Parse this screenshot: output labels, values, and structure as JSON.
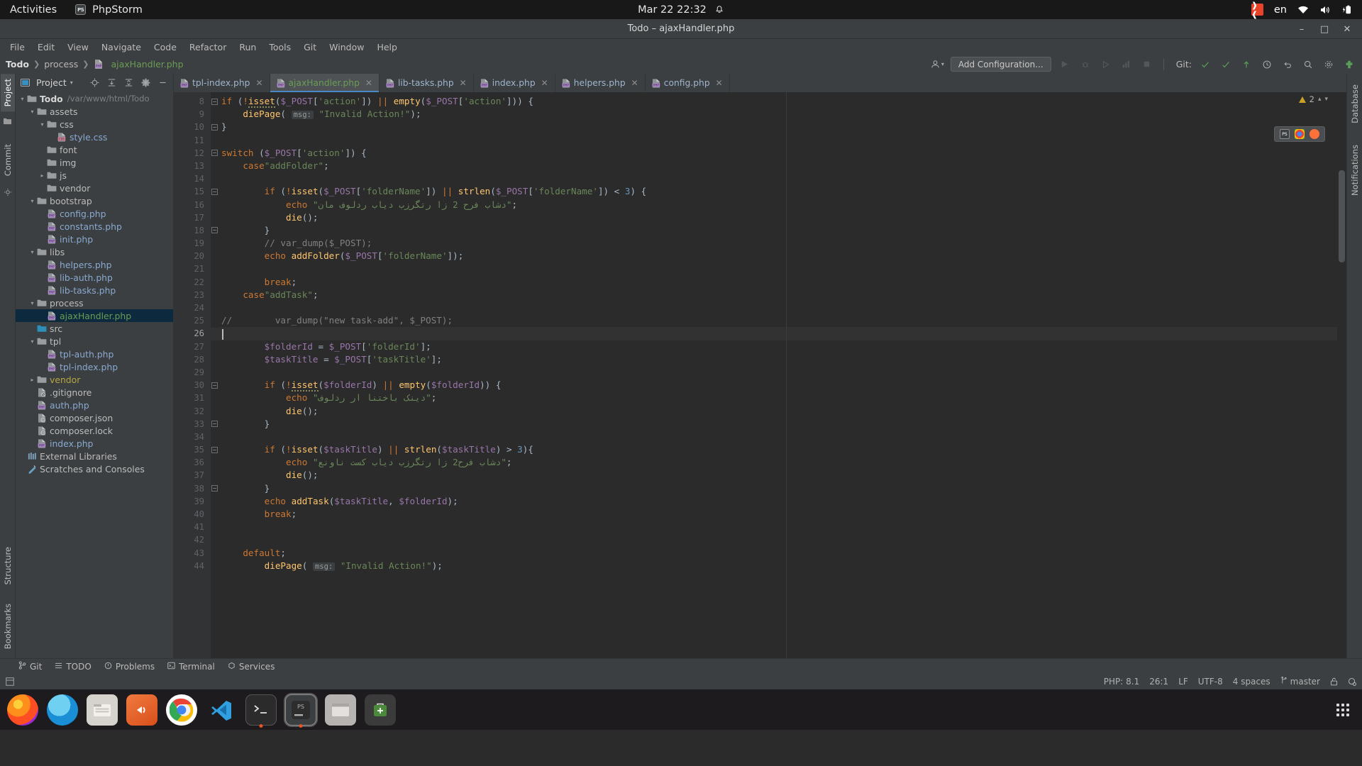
{
  "gnome": {
    "activities": "Activities",
    "app_name": "PhpStorm",
    "app_icon": "phpstorm-icon",
    "clock": "Mar 22  22:32",
    "bell_icon": "notification-bell-icon",
    "tray_icon": "redhat-tray-icon",
    "language": "en",
    "wifi_icon": "wifi-icon",
    "volume_icon": "volume-icon",
    "battery_icon": "battery-charging-icon"
  },
  "window": {
    "title": "Todo – ajaxHandler.php",
    "minimize": "–",
    "maximize": "□",
    "close": "✕"
  },
  "menu": [
    "File",
    "Edit",
    "View",
    "Navigate",
    "Code",
    "Refactor",
    "Run",
    "Tools",
    "Git",
    "Window",
    "Help"
  ],
  "navbar": {
    "breadcrumb": [
      "Todo",
      "process",
      "ajaxHandler.php"
    ],
    "add_configuration": "Add Configuration...",
    "git_label": "Git:",
    "icons": [
      "user-profile-icon",
      "run-icon",
      "debug-icon",
      "run-with-coverage-icon",
      "profile-icon",
      "stop-icon",
      "git-update-icon",
      "git-commit-icon",
      "git-push-icon",
      "git-history-icon",
      "undo-icon",
      "search-icon",
      "settings-icon",
      "plugin-icon"
    ]
  },
  "left_strip": {
    "tabs": [
      "Project",
      "Commit"
    ],
    "bottom_tabs": [
      "Structure",
      "Bookmarks"
    ],
    "active": "Project"
  },
  "right_strip": {
    "tabs": [
      "Database",
      "Notifications"
    ]
  },
  "project_panel": {
    "title": "Project",
    "icons": [
      "locate-icon",
      "expand-all-icon",
      "collapse-all-icon",
      "settings-icon",
      "hide-icon"
    ],
    "tree": [
      {
        "label": "Todo",
        "sub": "/var/www/html/Todo",
        "depth": 0,
        "arrow": "down",
        "icon": "folder-icon",
        "style": "b",
        "sel": false
      },
      {
        "label": "assets",
        "sub": "",
        "depth": 1,
        "arrow": "down",
        "icon": "folder-icon",
        "style": "plain",
        "sel": false
      },
      {
        "label": "css",
        "sub": "",
        "depth": 2,
        "arrow": "down",
        "icon": "folder-icon",
        "style": "plain",
        "sel": false
      },
      {
        "label": "style.css",
        "sub": "",
        "depth": 3,
        "arrow": "",
        "icon": "css-file-icon",
        "style": "css",
        "sel": false
      },
      {
        "label": "font",
        "sub": "",
        "depth": 2,
        "arrow": "",
        "icon": "folder-icon",
        "style": "plain",
        "sel": false
      },
      {
        "label": "img",
        "sub": "",
        "depth": 2,
        "arrow": "",
        "icon": "folder-icon",
        "style": "plain",
        "sel": false
      },
      {
        "label": "js",
        "sub": "",
        "depth": 2,
        "arrow": "right",
        "icon": "folder-icon",
        "style": "plain",
        "sel": false
      },
      {
        "label": "vendor",
        "sub": "",
        "depth": 2,
        "arrow": "",
        "icon": "folder-icon",
        "style": "plain",
        "sel": false
      },
      {
        "label": "bootstrap",
        "sub": "",
        "depth": 1,
        "arrow": "down",
        "icon": "folder-icon",
        "style": "plain",
        "sel": false
      },
      {
        "label": "config.php",
        "sub": "",
        "depth": 2,
        "arrow": "",
        "icon": "php-file-icon",
        "style": "php",
        "sel": false
      },
      {
        "label": "constants.php",
        "sub": "",
        "depth": 2,
        "arrow": "",
        "icon": "php-file-icon",
        "style": "php",
        "sel": false
      },
      {
        "label": "init.php",
        "sub": "",
        "depth": 2,
        "arrow": "",
        "icon": "php-file-icon",
        "style": "php",
        "sel": false
      },
      {
        "label": "libs",
        "sub": "",
        "depth": 1,
        "arrow": "down",
        "icon": "folder-icon",
        "style": "plain",
        "sel": false
      },
      {
        "label": "helpers.php",
        "sub": "",
        "depth": 2,
        "arrow": "",
        "icon": "php-file-icon",
        "style": "php",
        "sel": false
      },
      {
        "label": "lib-auth.php",
        "sub": "",
        "depth": 2,
        "arrow": "",
        "icon": "php-file-icon",
        "style": "php",
        "sel": false
      },
      {
        "label": "lib-tasks.php",
        "sub": "",
        "depth": 2,
        "arrow": "",
        "icon": "php-file-icon",
        "style": "php",
        "sel": false
      },
      {
        "label": "process",
        "sub": "",
        "depth": 1,
        "arrow": "down",
        "icon": "folder-icon",
        "style": "plain",
        "sel": false
      },
      {
        "label": "ajaxHandler.php",
        "sub": "",
        "depth": 2,
        "arrow": "",
        "icon": "php-file-icon",
        "style": "green",
        "sel": true
      },
      {
        "label": "src",
        "sub": "",
        "depth": 1,
        "arrow": "",
        "icon": "folder-blue-icon",
        "style": "plain",
        "sel": false
      },
      {
        "label": "tpl",
        "sub": "",
        "depth": 1,
        "arrow": "down",
        "icon": "folder-icon",
        "style": "plain",
        "sel": false
      },
      {
        "label": "tpl-auth.php",
        "sub": "",
        "depth": 2,
        "arrow": "",
        "icon": "php-file-icon",
        "style": "php",
        "sel": false
      },
      {
        "label": "tpl-index.php",
        "sub": "",
        "depth": 2,
        "arrow": "",
        "icon": "php-file-icon",
        "style": "php",
        "sel": false
      },
      {
        "label": "vendor",
        "sub": "",
        "depth": 1,
        "arrow": "right",
        "icon": "folder-icon",
        "style": "yellow",
        "sel": false
      },
      {
        "label": ".gitignore",
        "sub": "",
        "depth": 1,
        "arrow": "",
        "icon": "gitignore-file-icon",
        "style": "plain",
        "sel": false
      },
      {
        "label": "auth.php",
        "sub": "",
        "depth": 1,
        "arrow": "",
        "icon": "php-file-icon",
        "style": "php",
        "sel": false
      },
      {
        "label": "composer.json",
        "sub": "",
        "depth": 1,
        "arrow": "",
        "icon": "composer-file-icon",
        "style": "plain",
        "sel": false
      },
      {
        "label": "composer.lock",
        "sub": "",
        "depth": 1,
        "arrow": "",
        "icon": "composer-file-icon",
        "style": "plain",
        "sel": false
      },
      {
        "label": "index.php",
        "sub": "",
        "depth": 1,
        "arrow": "",
        "icon": "php-file-icon",
        "style": "php",
        "sel": false
      },
      {
        "label": "External Libraries",
        "sub": "",
        "depth": 0,
        "arrow": "",
        "icon": "external-libraries-icon",
        "style": "plain",
        "sel": false
      },
      {
        "label": "Scratches and Consoles",
        "sub": "",
        "depth": 0,
        "arrow": "",
        "icon": "scratches-icon",
        "style": "plain",
        "sel": false
      }
    ]
  },
  "tabs": [
    {
      "label": "tpl-index.php",
      "active": false
    },
    {
      "label": "ajaxHandler.php",
      "active": true
    },
    {
      "label": "lib-tasks.php",
      "active": false
    },
    {
      "label": "index.php",
      "active": false
    },
    {
      "label": "helpers.php",
      "active": false
    },
    {
      "label": "config.php",
      "active": false
    }
  ],
  "editor": {
    "first_line": 8,
    "current_line": 26,
    "inspections": "2",
    "browser_popup_icons": [
      "phpstorm-run-icon",
      "chrome-icon",
      "firefox-icon"
    ],
    "lines": [
      {
        "n": 8,
        "html": "<span class=\"k\">if</span> (<span class=\"k\">!</span><span class=\"f squig\">isset</span>(<span class=\"v\">$_POST</span>[<span class=\"s\">'action'</span>])<span class=\"p\"> </span><span class=\"pipe\">||</span> <span class=\"f\">empty</span>(<span class=\"v\">$_POST</span>[<span class=\"s\">'action'</span>])) {"
      },
      {
        "n": 9,
        "html": "    <span class=\"f\">diePage</span>( <span class=\"hint\">msg:</span> <span class=\"s\">\"Invalid Action!\"</span>);"
      },
      {
        "n": 10,
        "html": "}"
      },
      {
        "n": 11,
        "html": ""
      },
      {
        "n": 12,
        "html": "<span class=\"k\">switch</span> (<span class=\"v\">$_POST</span>[<span class=\"s\">'action'</span>]) {"
      },
      {
        "n": 13,
        "html": "    <span class=\"k\">case</span><span class=\"s\">\"addFolder\"</span>;"
      },
      {
        "n": 14,
        "html": ""
      },
      {
        "n": 15,
        "html": "        <span class=\"k\">if</span> (<span class=\"k\">!</span><span class=\"f\">isset</span>(<span class=\"v\">$_POST</span>[<span class=\"s\">'folderName'</span>])<span class=\"p\"> </span><span class=\"pipe\">||</span> <span class=\"f\">strlen</span>(<span class=\"v\">$_POST</span>[<span class=\"s\">'folderName'</span>]) &lt; <span class=\"n\">3</span>) {"
      },
      {
        "n": 16,
        "html": "            <span class=\"k\">echo</span> <span class=\"s\">\"<span class=\"rtl\">دشاب فرح 2 زا رتگرزب دیاب ردلوف مان</span>\"</span>;"
      },
      {
        "n": 17,
        "html": "            <span class=\"f\">die</span>();"
      },
      {
        "n": 18,
        "html": "        }"
      },
      {
        "n": 19,
        "html": "        <span class=\"c\">// var_dump($_POST);</span>"
      },
      {
        "n": 20,
        "html": "        <span class=\"k\">echo</span> <span class=\"f\">addFolder</span>(<span class=\"v\">$_POST</span>[<span class=\"s\">'folderName'</span>]);"
      },
      {
        "n": 21,
        "html": ""
      },
      {
        "n": 22,
        "html": "        <span class=\"k\">break</span>;"
      },
      {
        "n": 23,
        "html": "    <span class=\"k\">case</span><span class=\"s\">\"addTask\"</span>;"
      },
      {
        "n": 24,
        "html": ""
      },
      {
        "n": 25,
        "html": "<span class=\"c\">//        var_dump(\"new task-add\", $_POST);</span>"
      },
      {
        "n": 26,
        "html": ""
      },
      {
        "n": 27,
        "html": "        <span class=\"v\">$folderId</span> = <span class=\"v\">$_POST</span>[<span class=\"s\">'folderId'</span>];"
      },
      {
        "n": 28,
        "html": "        <span class=\"v\">$taskTitle</span> = <span class=\"v\">$_POST</span>[<span class=\"s\">'taskTitle'</span>];"
      },
      {
        "n": 29,
        "html": ""
      },
      {
        "n": 30,
        "html": "        <span class=\"k\">if</span> (<span class=\"k\">!</span><span class=\"f squig\">isset</span>(<span class=\"v\">$folderId</span>)<span class=\"p\"> </span><span class=\"pipe\">||</span> <span class=\"f\">empty</span>(<span class=\"v\">$folderId</span>)) {"
      },
      {
        "n": 31,
        "html": "            <span class=\"k\">echo</span> <span class=\"s\">\"<span class=\"rtl\">دینک باختنا ار ردلوف</span>\"</span>;"
      },
      {
        "n": 32,
        "html": "            <span class=\"f\">die</span>();"
      },
      {
        "n": 33,
        "html": "        }"
      },
      {
        "n": 34,
        "html": ""
      },
      {
        "n": 35,
        "html": "        <span class=\"k\">if</span> (<span class=\"k\">!</span><span class=\"f\">isset</span>(<span class=\"v\">$taskTitle</span>)<span class=\"p\"> </span><span class=\"pipe\">||</span> <span class=\"f\">strlen</span>(<span class=\"v\">$taskTitle</span>) &gt; <span class=\"n\">3</span>){"
      },
      {
        "n": 36,
        "html": "            <span class=\"k\">echo</span> <span class=\"s\">\"<span class=\"rtl\">دشاب فرح2 زا رتگرزب دیاب کست ناونع</span>\"</span>;"
      },
      {
        "n": 37,
        "html": "            <span class=\"f\">die</span>();"
      },
      {
        "n": 38,
        "html": "        }"
      },
      {
        "n": 39,
        "html": "        <span class=\"k\">echo</span> <span class=\"f\">addTask</span>(<span class=\"v\">$taskTitle</span>, <span class=\"v\">$folderId</span>);"
      },
      {
        "n": 40,
        "html": "        <span class=\"k\">break</span>;"
      },
      {
        "n": 41,
        "html": ""
      },
      {
        "n": 42,
        "html": ""
      },
      {
        "n": 43,
        "html": "    <span class=\"k\">default</span>;"
      },
      {
        "n": 44,
        "html": "        <span class=\"f\">diePage</span>( <span class=\"hint\">msg:</span> <span class=\"s\">\"Invalid Action!\"</span>);"
      }
    ]
  },
  "bottom_strip": [
    {
      "label": "Git",
      "icon": "git-branch-icon"
    },
    {
      "label": "TODO",
      "icon": "todo-list-icon"
    },
    {
      "label": "Problems",
      "icon": "problems-icon"
    },
    {
      "label": "Terminal",
      "icon": "terminal-icon"
    },
    {
      "label": "Services",
      "icon": "services-icon"
    }
  ],
  "status_bar": {
    "php_version": "PHP: 8.1",
    "caret": "26:1",
    "line_sep": "LF",
    "encoding": "UTF-8",
    "indent": "4 spaces",
    "branch": "master",
    "lock_icon": "unlocked-icon",
    "inspector_icon": "inspection-icon"
  },
  "dock": [
    {
      "name": "firefox",
      "label": "",
      "color": "#ff7139",
      "running": false
    },
    {
      "name": "thunderbird",
      "label": "",
      "color": "#1e90d8",
      "running": false
    },
    {
      "name": "files",
      "label": "",
      "color": "#c8c5c2",
      "running": false
    },
    {
      "name": "rhythmbox",
      "label": "",
      "color": "#e95420",
      "running": false
    },
    {
      "name": "chrome",
      "label": "",
      "color": "#e8e8e8",
      "running": true
    },
    {
      "name": "vscode",
      "label": "",
      "color": "#2b8fd0",
      "running": false
    },
    {
      "name": "terminal",
      "label": "",
      "color": "#2d2d2d",
      "running": true
    },
    {
      "name": "phpstorm",
      "label": "",
      "color": "#3c3f41",
      "running": true
    },
    {
      "name": "file-manager",
      "label": "",
      "color": "#b6b3b0",
      "running": false
    },
    {
      "name": "software",
      "label": "",
      "color": "#4b8a3b",
      "running": false
    }
  ],
  "colors": {
    "accent_blue": "#4a88c7",
    "selection": "#0d293e",
    "keyword": "#cc7832",
    "string": "#6a8759",
    "variable": "#9876aa",
    "function": "#ffc66d",
    "ubuntu_orange": "#e95420"
  }
}
